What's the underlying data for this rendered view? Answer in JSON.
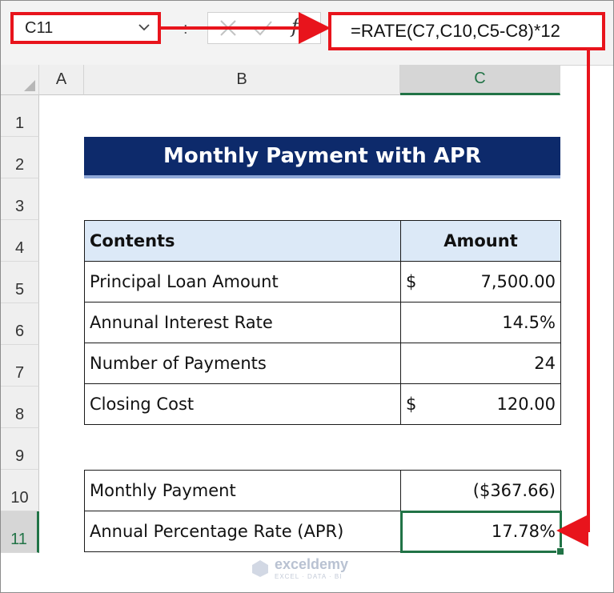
{
  "formula_bar": {
    "name_box": "C11",
    "colon": ":",
    "fx_label": "fx",
    "formula": "=RATE(C7,C10,C5-C8)*12"
  },
  "columns": [
    "A",
    "B",
    "C"
  ],
  "rows": [
    "1",
    "2",
    "3",
    "4",
    "5",
    "6",
    "7",
    "8",
    "9",
    "10",
    "11"
  ],
  "selected_cell": "C11",
  "title": "Monthly Payment with APR",
  "table": {
    "headers": [
      "Contents",
      "Amount"
    ],
    "rows": [
      {
        "label": "Principal Loan Amount",
        "currency": "$",
        "value": "7,500.00"
      },
      {
        "label": "Annunal Interest Rate",
        "currency": "",
        "value": "14.5%"
      },
      {
        "label": "Number of Payments",
        "currency": "",
        "value": "24"
      },
      {
        "label": "Closing Cost",
        "currency": "$",
        "value": "120.00"
      }
    ]
  },
  "results": [
    {
      "label": "Monthly Payment",
      "value": "($367.66)",
      "color": "#e8141c"
    },
    {
      "label": "Annual Percentage Rate (APR)",
      "value": "17.78%",
      "color": "#111111"
    }
  ],
  "watermark": {
    "name": "exceldemy",
    "tagline": "EXCEL · DATA · BI"
  },
  "colors": {
    "accent_red": "#e8141c",
    "excel_green": "#217346",
    "title_bg": "#0d2a6b",
    "header_bg": "#dce9f7"
  }
}
